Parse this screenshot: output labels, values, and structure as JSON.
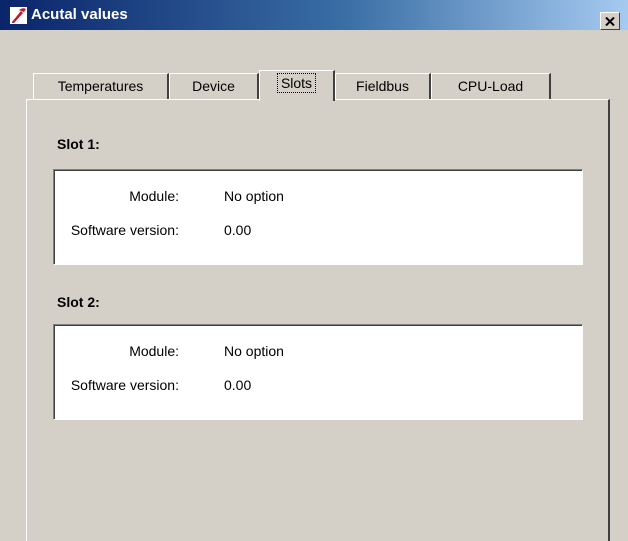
{
  "window": {
    "title": "Acutal values",
    "close_symbol": "x-close-icon"
  },
  "tabs": [
    {
      "label": "Temperatures",
      "active": false
    },
    {
      "label": "Device",
      "active": false
    },
    {
      "label": "Slots",
      "active": true
    },
    {
      "label": "Fieldbus",
      "active": false
    },
    {
      "label": "CPU-Load",
      "active": false
    }
  ],
  "slots": [
    {
      "heading": "Slot 1:",
      "module_label": "Module:",
      "module_value": "No option",
      "software_label": "Software version:",
      "software_value": "0.00"
    },
    {
      "heading": "Slot 2:",
      "module_label": "Module:",
      "module_value": "No option",
      "software_label": "Software version:",
      "software_value": "0.00"
    }
  ],
  "colors": {
    "titlebar_start": "#0a246a",
    "titlebar_end": "#a6caf0",
    "face": "#d4d0c8"
  }
}
